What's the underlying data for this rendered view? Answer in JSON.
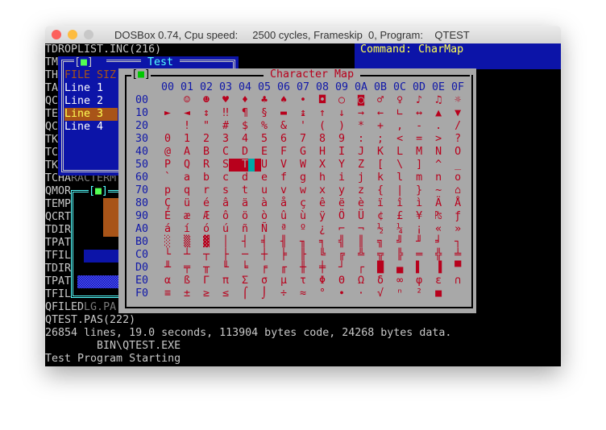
{
  "window": {
    "title": "DOSBox 0.74, Cpu speed:     2500 cycles, Frameskip  0, Program:    QTEST",
    "buttons": [
      "close",
      "minimize",
      "zoom"
    ],
    "colors": {
      "close": "#fc605c",
      "minimize": "#fdbc40",
      "zoom": "#c8c8c8"
    }
  },
  "command_bar": {
    "text": "Command: CharMap"
  },
  "background_lines": [
    {
      "white": "TDROPLIST.INC(216)",
      "gray": ""
    },
    {
      "white": "TM",
      "gray": ""
    },
    {
      "white": "TH",
      "gray": ""
    },
    {
      "white": "TA",
      "gray": ""
    },
    {
      "white": "QC",
      "gray": ""
    },
    {
      "white": "TE",
      "gray": ""
    },
    {
      "white": "QC",
      "gray": ""
    },
    {
      "white": "TK",
      "gray": ""
    },
    {
      "white": "TC",
      "gray": ""
    },
    {
      "white": "TK",
      "gray": ""
    },
    {
      "white": "TCHA",
      "gray": "RACTERM"
    },
    {
      "white": "QMOR",
      "gray": ""
    },
    {
      "white": "TEMP",
      "gray": ""
    },
    {
      "white": "QCRT",
      "gray": ""
    },
    {
      "white": "TDIR",
      "gray": ""
    },
    {
      "white": "TPAT",
      "gray": ""
    },
    {
      "white": "TFIL",
      "gray": ""
    },
    {
      "white": "TDIR",
      "gray": ""
    },
    {
      "white": "TPAT",
      "gray": ""
    },
    {
      "white": "TFIL",
      "gray": ""
    },
    {
      "white": "QFILED",
      "gray": "LG.PA"
    },
    {
      "white": "QTEST.PAS(222)",
      "gray": ""
    },
    {
      "white": "26854 lines, 19.0 seconds, 113904 bytes code, 24268 bytes data.",
      "gray": ""
    },
    {
      "white": "        BIN\\QTEST.EXE",
      "gray": ""
    },
    {
      "white": "Test Program Starting",
      "gray": ""
    }
  ],
  "test_window": {
    "title": "Test",
    "column_header": "FILE SIZ",
    "items": [
      "Line 1",
      "Line 2",
      "Line 3",
      "Line 4"
    ],
    "selected_index": 2
  },
  "char_map": {
    "title": "Character Map",
    "col_headers": [
      "00",
      "01",
      "02",
      "03",
      "04",
      "05",
      "06",
      "07",
      "08",
      "09",
      "0A",
      "0B",
      "0C",
      "0D",
      "0E",
      "0F"
    ],
    "row_headers": [
      "00",
      "10",
      "20",
      "30",
      "40",
      "50",
      "60",
      "70",
      "80",
      "90",
      "A0",
      "B0",
      "C0",
      "D0",
      "E0",
      "F0"
    ],
    "rows": [
      " ☺☻♥♦♣♠•◘○◙♂♀♪♫☼",
      "►◄↕‼¶§▬↨↑↓→←∟↔▲▼",
      " !\"#$%&'()*+,-./",
      "0123456789:;<=>?",
      "@ABCDEFGHIJKLMNO",
      "PQRSTUVWXYZ[\\]^_",
      "`abcdefghijklmno",
      "pqrstuvwxyz{|}~⌂",
      "ÇüéâäàåçêëèïîìÄÅ",
      "ÉæÆôöòûùÿÖÜ¢£¥₧ƒ",
      "áíóúñÑªº¿⌐¬½¼¡«»",
      "░▒▓│┤╡╢╖╕╣║╗╝╜╛┐",
      "└┴┬├─┼╞╟╚╔╩╦╠═╬╧",
      "╨╤╥╙╘╒╓╫╪┘┌█▄▌▐▀",
      "αßΓπΣσµτΦΘΩδ∞φε∩",
      "≡±≥≤⌠⌡÷≈°∙·√ⁿ²■ "
    ],
    "selected": {
      "row": "50",
      "col": "04"
    },
    "colors": {
      "glyph": "#b8001c",
      "header": "#1018a8",
      "background": "#a8a8a8",
      "selection": "#b8001c",
      "cursor": "#00a8a8"
    }
  }
}
